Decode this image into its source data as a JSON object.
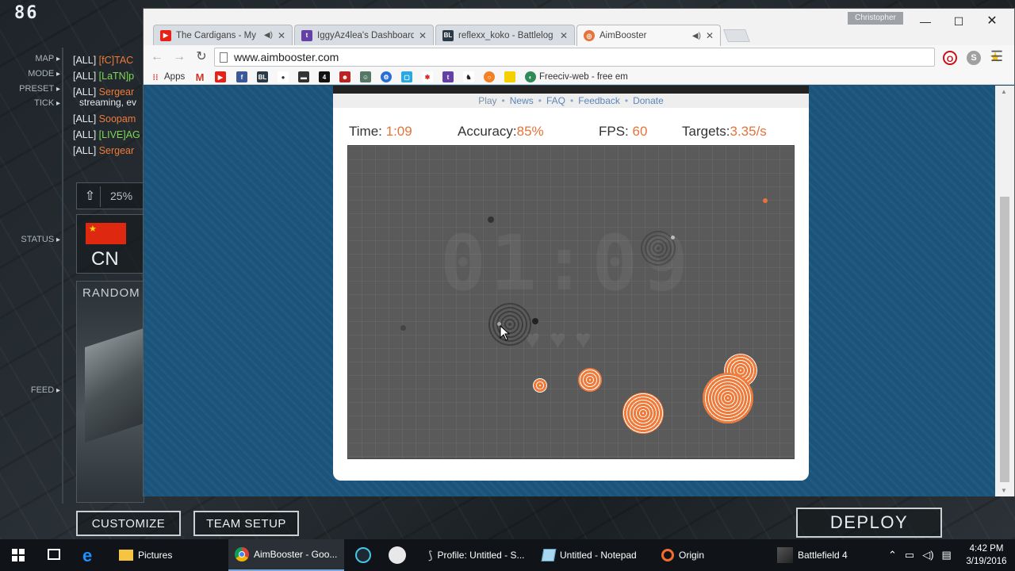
{
  "game": {
    "player_count": "86",
    "side_labels": [
      "MAP",
      "MODE",
      "PRESET",
      "TICK",
      "STATUS",
      "FEED"
    ],
    "chat": [
      {
        "tag": "[ALL]",
        "name": "[fC]TAC",
        "color": "orange"
      },
      {
        "tag": "[ALL]",
        "name": "[LaTN]p",
        "color": "green"
      },
      {
        "tag": "[ALL]",
        "name": "Sergear",
        "color": "orange"
      },
      {
        "tag": "",
        "name": "streaming, ev",
        "color": "white"
      },
      {
        "tag": "[ALL]",
        "name": "Soopam",
        "color": "orange"
      },
      {
        "tag": "[ALL]",
        "name": "[LIVE]AG",
        "color": "green"
      },
      {
        "tag": "[ALL]",
        "name": "Sergear",
        "color": "orange"
      }
    ],
    "zoom_pct": "25%",
    "country": "CN",
    "random_label": "RANDOM",
    "customize_label": "CUSTOMIZE",
    "team_setup_label": "TEAM SETUP",
    "deploy_label": "DEPLOY"
  },
  "browser": {
    "user": "Christopher",
    "tabs": [
      {
        "title": "The Cardigans - My Fa",
        "icon": "youtube-icon",
        "color": "#e62117",
        "audio": true
      },
      {
        "title": "IggyAz4lea's Dashboard -",
        "icon": "twitch-icon",
        "color": "#6441a5",
        "audio": false
      },
      {
        "title": "reflexx_koko - Battlelog /",
        "icon": "battlelog-icon",
        "color": "#2b3a47",
        "audio": false
      },
      {
        "title": "AimBooster",
        "icon": "aimbooster-icon",
        "color": "#e5733a",
        "audio": true
      }
    ],
    "url": "www.aimbooster.com",
    "bookmarks_apps": "Apps",
    "bookmark_last": "Freeciv-web - free em"
  },
  "aimbooster": {
    "nav": [
      "Play",
      "News",
      "FAQ",
      "Feedback",
      "Donate"
    ],
    "time_label": "Time:",
    "time_value": "1:09",
    "accuracy_label": "Accuracy:",
    "accuracy_value": "85%",
    "fps_label": "FPS:",
    "fps_value": "60",
    "targets_label": "Targets:",
    "targets_value": "3.35/s",
    "big_timer": "01:09",
    "hearts": "♥♥♥"
  },
  "taskbar": {
    "items": [
      {
        "label": "Pictures",
        "icon": "folder-icon"
      },
      {
        "label": "AimBooster - Goo...",
        "icon": "chrome-icon"
      },
      {
        "label": "",
        "icon": "alienware-icon"
      },
      {
        "label": "",
        "icon": "steam-icon"
      },
      {
        "label": "Profile: Untitled - S...",
        "icon": "profile-icon"
      },
      {
        "label": "Untitled - Notepad",
        "icon": "notepad-icon"
      },
      {
        "label": "Origin",
        "icon": "origin-icon"
      },
      {
        "label": "Battlefield 4",
        "icon": "bf4-icon"
      }
    ],
    "time": "4:42 PM",
    "date": "3/19/2016"
  },
  "colors": {
    "accent": "#e5733a",
    "page_bg": "#1d5680",
    "field": "#5a5a5a"
  }
}
